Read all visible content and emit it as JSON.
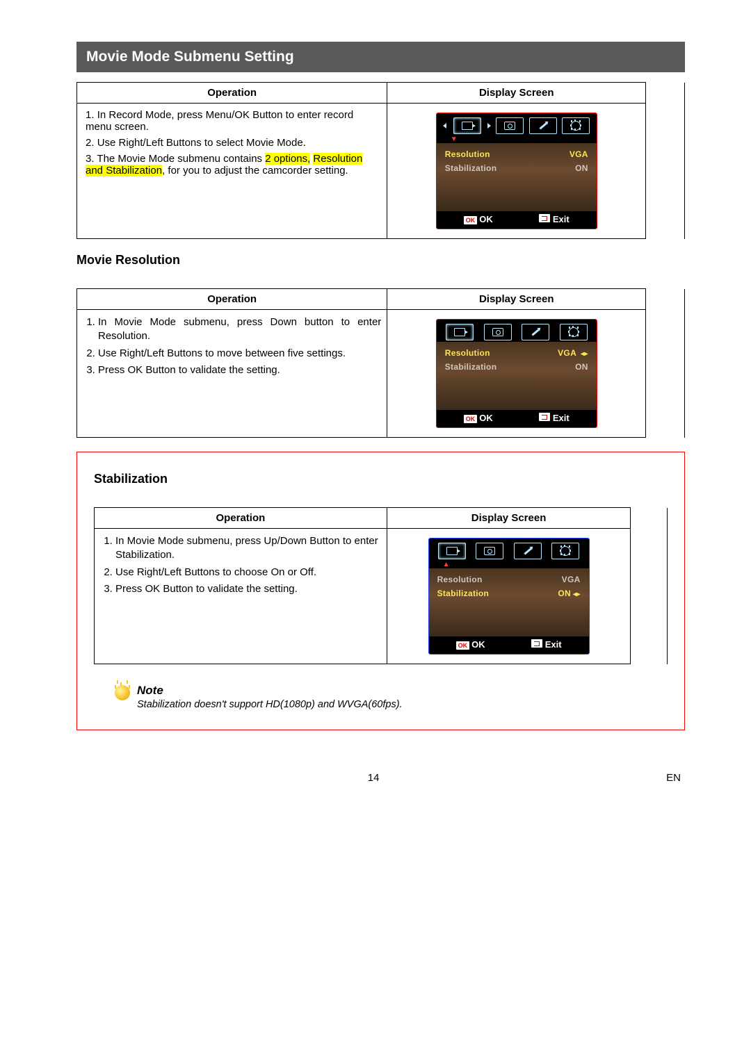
{
  "title": "Movie Mode Submenu Setting",
  "headers": {
    "operation": "Operation",
    "display": "Display Screen"
  },
  "section1": {
    "steps": [
      "In Record Mode, press Menu/OK Button to enter record menu screen.",
      "Use Right/Left Buttons to select Movie Mode.",
      {
        "pre": "The Movie Mode submenu contains ",
        "hl1": "2 options,",
        "mid": " ",
        "hl2": "Resolution and Stabilization",
        "post": ", for you to adjust the camcorder setting."
      }
    ],
    "lcd": {
      "rows": [
        {
          "label": "Resolution",
          "value": "VGA",
          "highlight": true
        },
        {
          "label": "Stabilization",
          "value": "ON"
        }
      ],
      "ok": "OK",
      "exit": "Exit",
      "okBadge": "OK"
    }
  },
  "section2": {
    "heading": "Movie Resolution",
    "steps": [
      "In Movie Mode submenu, press Down button to enter Resolution.",
      "Use Right/Left Buttons to move between five settings.",
      "Press OK Button to validate the setting."
    ],
    "lcd": {
      "rows": [
        {
          "label": "Resolution",
          "value": "VGA",
          "highlight": true,
          "arrows": true
        },
        {
          "label": "Stabilization",
          "value": "ON"
        }
      ],
      "ok": "OK",
      "exit": "Exit",
      "okBadge": "OK"
    }
  },
  "section3": {
    "heading": "Stabilization",
    "steps": [
      "In Movie Mode submenu, press Up/Down Button to enter Stabilization.",
      "Use Right/Left Buttons to choose On or Off.",
      "Press OK Button to validate the setting."
    ],
    "lcd": {
      "rows": [
        {
          "label": "Resolution",
          "value": "VGA"
        },
        {
          "label": "Stabilization",
          "value": "ON",
          "highlight": true,
          "arrows": true
        }
      ],
      "ok": "OK",
      "exit": "Exit",
      "okBadge": "OK"
    },
    "note": {
      "title": "Note",
      "text": "Stabilization doesn't support HD(1080p) and WVGA(60fps)."
    }
  },
  "footer": {
    "page": "14",
    "lang": "EN"
  }
}
